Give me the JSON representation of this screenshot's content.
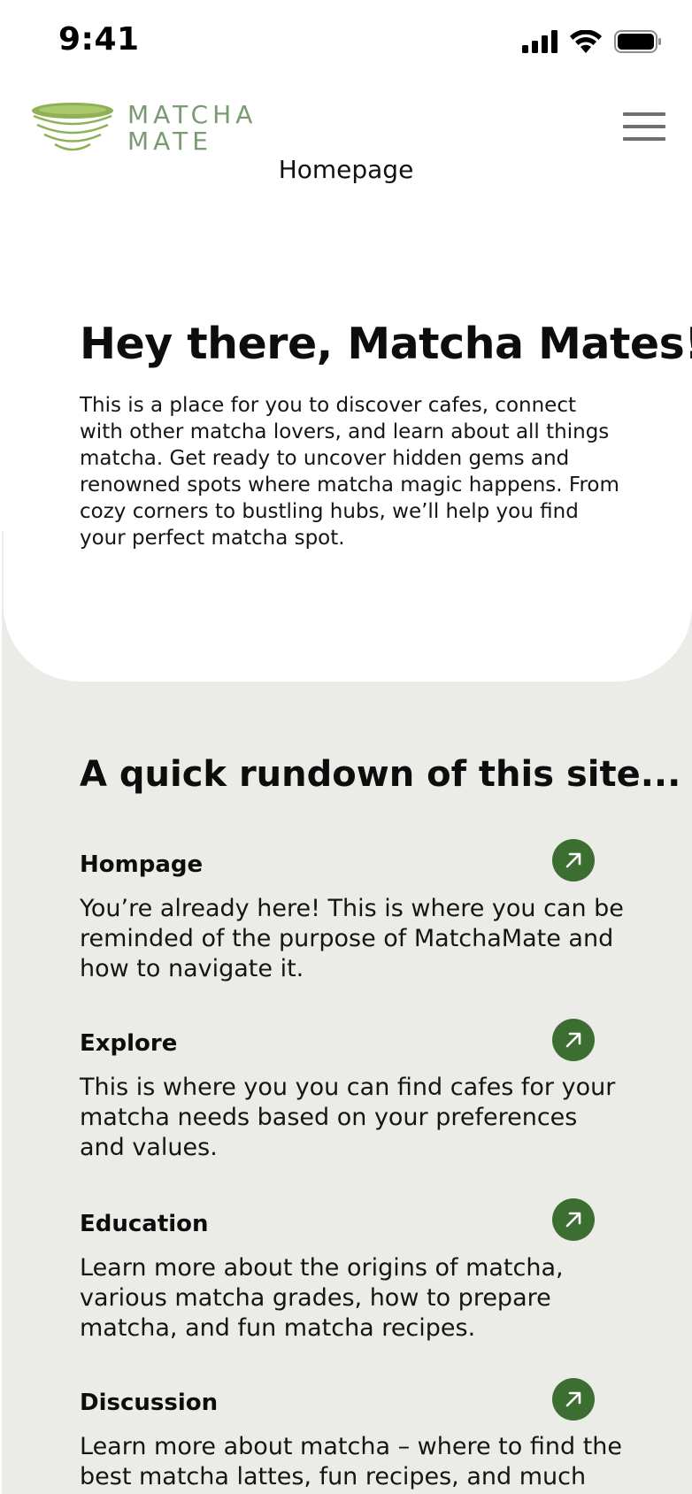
{
  "status_bar": {
    "time": "9:41"
  },
  "header": {
    "logo_line1": "MATCHA",
    "logo_line2": "MATE",
    "page_label": "Homepage"
  },
  "hero": {
    "title": "Hey there, Matcha Mates!",
    "body": "This is a place for you to discover cafes, connect with other matcha lovers, and learn about all things matcha. Get ready to uncover hidden gems and renowned spots where matcha magic happens. From cozy corners to bustling hubs, we’ll help you find your perfect matcha spot."
  },
  "rundown": {
    "title": "A quick rundown of this site...",
    "items": [
      {
        "title": "Hompage",
        "description": "You’re already here! This is where you can be reminded of the purpose of MatchaMate and how to navigate it."
      },
      {
        "title": "Explore",
        "description": "This is where you you can find cafes for your matcha needs based on your preferences and values."
      },
      {
        "title": "Education",
        "description": "Learn more about the origins of matcha, various matcha grades, how to prepare matcha, and fun matcha recipes."
      },
      {
        "title": "Discussion",
        "description": "Learn more about matcha – where to find the best matcha lattes, fun recipes, and much"
      }
    ]
  },
  "colors": {
    "accent": "#3b6e30",
    "logo": "#7a9a72",
    "section_bg": "#ebebe7"
  },
  "icons": {
    "menu": "hamburger-menu-icon",
    "arrow": "arrow-up-right-icon"
  }
}
